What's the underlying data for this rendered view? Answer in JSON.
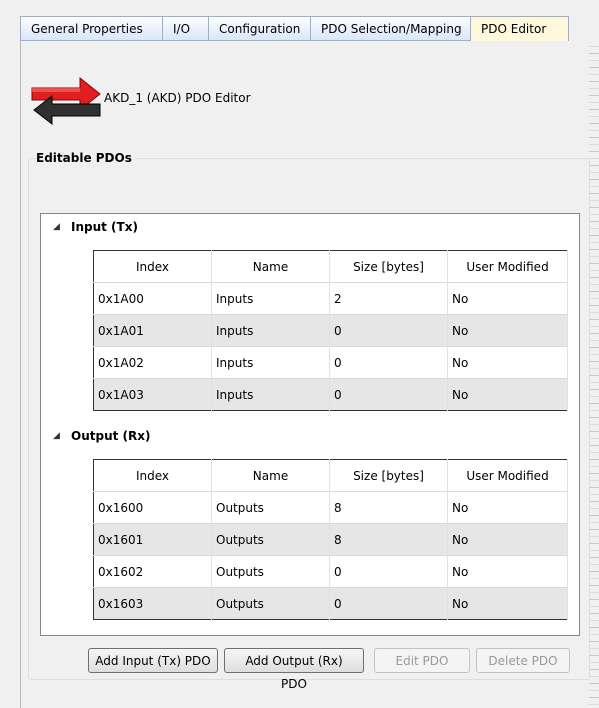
{
  "tabs": [
    {
      "label": "General Properties",
      "active": false
    },
    {
      "label": "I/O",
      "active": false
    },
    {
      "label": "Configuration",
      "active": false
    },
    {
      "label": "PDO Selection/Mapping",
      "active": false
    },
    {
      "label": "PDO Editor",
      "active": true
    }
  ],
  "header": {
    "title": "AKD_1 (AKD) PDO Editor",
    "icon": "pdo-arrows-icon"
  },
  "section": {
    "label": "Editable PDOs"
  },
  "table_columns": [
    "Index",
    "Name",
    "Size [bytes]",
    "User Modified"
  ],
  "input_group": {
    "label": "Input (Tx)",
    "rows": [
      [
        "0x1A00",
        "Inputs",
        "2",
        "No"
      ],
      [
        "0x1A01",
        "Inputs",
        "0",
        "No"
      ],
      [
        "0x1A02",
        "Inputs",
        "0",
        "No"
      ],
      [
        "0x1A03",
        "Inputs",
        "0",
        "No"
      ]
    ]
  },
  "output_group": {
    "label": "Output (Rx)",
    "rows": [
      [
        "0x1600",
        "Outputs",
        "8",
        "No"
      ],
      [
        "0x1601",
        "Outputs",
        "8",
        "No"
      ],
      [
        "0x1602",
        "Outputs",
        "0",
        "No"
      ],
      [
        "0x1603",
        "Outputs",
        "0",
        "No"
      ]
    ]
  },
  "buttons": {
    "add_input": "Add Input (Tx) PDO",
    "add_output": "Add Output (Rx) PDO",
    "edit": "Edit PDO",
    "delete": "Delete PDO"
  },
  "colors": {
    "active_tab": "#fff8dc",
    "icon_red": "#e02020",
    "icon_dark": "#303030"
  }
}
